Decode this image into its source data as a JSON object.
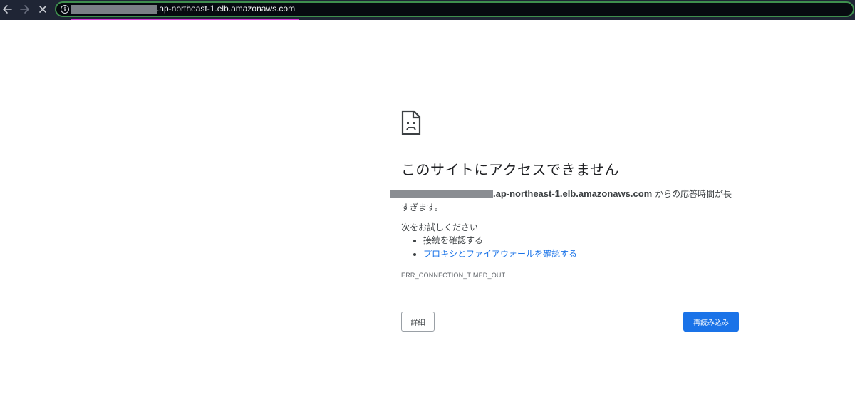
{
  "browser": {
    "url_suffix": ".ap-northeast-1.elb.amazonaws.com",
    "icons": {
      "back": "arrow-left",
      "forward": "arrow-right",
      "stop": "x-mark",
      "site_info": "info-circle"
    },
    "colors": {
      "toolbar_bg": "#1f2535",
      "omnibox_border": "#3f8f4e",
      "loading_bar": "#d633d6"
    }
  },
  "error_page": {
    "icon": "sad-page-icon",
    "title": "このサイトにアクセスできません",
    "host": ".ap-northeast-1.elb.amazonaws.com",
    "message_suffix": " からの応答時間が長すぎます。",
    "suggest_heading": "次をお試しください",
    "suggestions": [
      {
        "label": "接続を確認する",
        "is_link": false
      },
      {
        "label": "プロキシとファイアウォールを確認する",
        "is_link": true
      }
    ],
    "error_code": "ERR_CONNECTION_TIMED_OUT",
    "details_button": "詳細",
    "reload_button": "再読み込み",
    "colors": {
      "link": "#1a73e8",
      "primary_button": "#1a73e8"
    }
  }
}
